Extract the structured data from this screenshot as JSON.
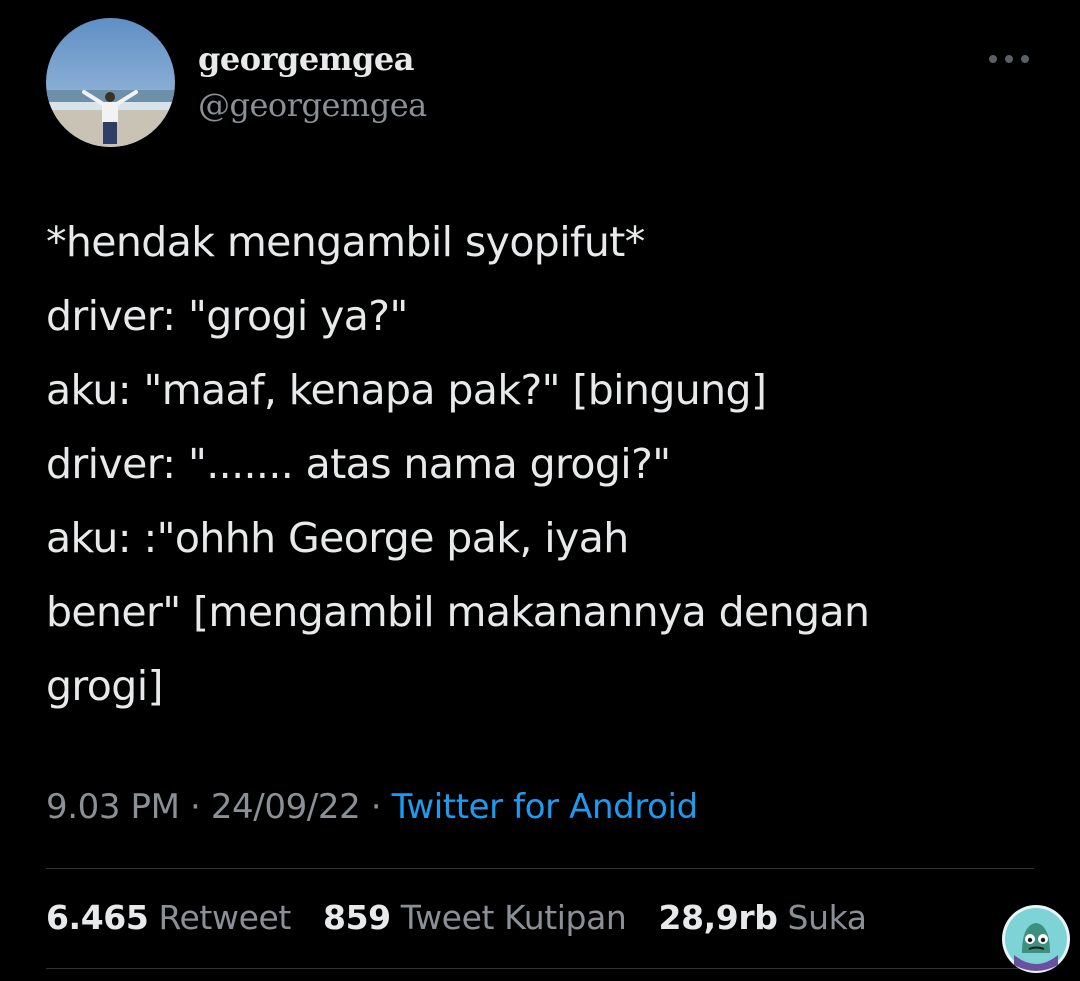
{
  "user": {
    "display_name": "georgemgea",
    "handle": "@georgemgea"
  },
  "tweet": {
    "lines": [
      "*hendak mengambil syopifut*",
      "driver: \"grogi ya?\"",
      "aku: \"maaf, kenapa pak?\" [bingung]",
      "driver: \"....... atas nama grogi?\"",
      "aku: :\"ohhh George pak, iyah",
      "bener\" [mengambil makanannya dengan",
      "grogi]"
    ]
  },
  "meta": {
    "time": "9.03 PM",
    "date": "24/09/22",
    "source": "Twitter for Android",
    "separator": "·"
  },
  "stats": {
    "retweets_count": "6.465",
    "retweets_label": "Retweet",
    "quotes_count": "859",
    "quotes_label": "Tweet Kutipan",
    "likes_count": "28,9rb",
    "likes_label": "Suka"
  },
  "icons": {
    "more": "more-horizontal-icon",
    "avatar": "profile-photo",
    "sticker": "watermark-sticker"
  },
  "colors": {
    "background": "#000000",
    "text_primary": "#e7e9ea",
    "text_secondary": "#8b9096",
    "link": "#1d9bf0",
    "divider": "#2f3336"
  }
}
